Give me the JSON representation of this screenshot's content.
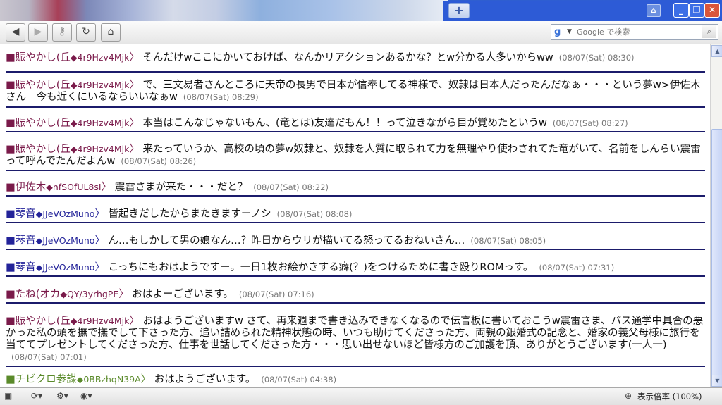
{
  "browser": {
    "search_placeholder": "Google で検索",
    "zoom_label": "表示倍率 (100%)"
  },
  "posts": [
    {
      "sq": "■",
      "name": "賑やかし(丘",
      "trip": "◆4r9Hzv4Mjk",
      "arrow": "〉",
      "text": "そんだけwここにかいておけば、なんかリアクションあるかな？とw分かる人多いからww",
      "time": "(08/07(Sat) 08:30)"
    },
    {
      "sq": "■",
      "name": "賑やかし(丘",
      "trip": "◆4r9Hzv4Mjk",
      "arrow": "〉",
      "text": "で、三文易者さんところに天帝の長男で日本が信奉してる神様で、奴隷は日本人だったんだなぁ・・・という夢w>伊佐木さん　今も近くにいるならいいなぁw",
      "time": "(08/07(Sat) 08:29)"
    },
    {
      "sq": "■",
      "name": "賑やかし(丘",
      "trip": "◆4r9Hzv4Mjk",
      "arrow": "〉",
      "text": "本当はこんなじゃないもん、(竜とは)友達だもん！！って泣きながら目が覚めたというw",
      "time": "(08/07(Sat) 08:27)"
    },
    {
      "sq": "■",
      "name": "賑やかし(丘",
      "trip": "◆4r9Hzv4Mjk",
      "arrow": "〉",
      "text": "来たっていうか、高校の頃の夢w奴隷と、奴隷を人質に取られて力を無理やり使わされてた竜がいて、名前をしんらい震雷って呼んでたんだよんw",
      "time": "(08/07(Sat) 08:26)"
    },
    {
      "sq": "■",
      "name": "伊佐木",
      "trip": "◆nfSOfUL8sI",
      "arrow": "〉",
      "text": "震雷さまが来た・・・だと？",
      "time": "(08/07(Sat) 08:22)"
    },
    {
      "sq": "■",
      "name": "琴音",
      "trip": "◆JJeVOzMuno",
      "arrow": "〉",
      "text": "皆起きだしたからまたきますーノシ",
      "time": "(08/07(Sat) 08:08)"
    },
    {
      "sq": "■",
      "name": "琴音",
      "trip": "◆JJeVOzMuno",
      "arrow": "〉",
      "text": "ん…もしかして男の娘なん…？昨日からウリが描いてる怒ってるおねいさん…",
      "time": "(08/07(Sat) 08:05)"
    },
    {
      "sq": "■",
      "name": "琴音",
      "trip": "◆JJeVOzMuno",
      "arrow": "〉",
      "text": "こっちにもおはようですー。一日1枚お絵かきする癖(？)をつけるために書き殴りROMっす。",
      "time": "(08/07(Sat) 07:31)"
    },
    {
      "sq": "■",
      "name": "たね(オカ",
      "trip": "◆QY/3yrhgPE",
      "arrow": "〉",
      "text": "おはよーございます。",
      "time": "(08/07(Sat) 07:16)"
    },
    {
      "sq": "■",
      "name": "賑やかし(丘",
      "trip": "◆4r9Hzv4Mjk",
      "arrow": "〉",
      "text": "おはようございますw さて、再来週まで書き込みできなくなるので伝言板に書いておこうw震雷さま、バス通学中具合の悪かった私の頭を撫で撫でして下さった方、追い詰められた精神状態の時、いつも助けてくださった方、両親の銀婚式の記念と、婚家の義父母様に旅行を当ててプレゼントしてくださった方、仕事を世話してくださった方・・・思い出せないほど皆様方のご加護を頂、ありがとうございます(一人一)",
      "time": "(08/07(Sat) 07:01)"
    },
    {
      "sq": "■",
      "name": "チビクロ参謀",
      "trip": "◆0BBzhqN39A",
      "arrow": "〉",
      "text": "おはようございます。",
      "time": "(08/07(Sat) 04:38)"
    }
  ]
}
